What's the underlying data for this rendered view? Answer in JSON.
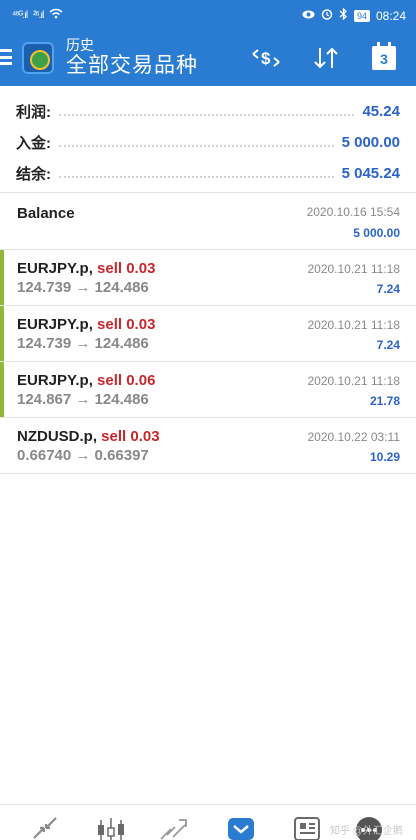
{
  "status_bar": {
    "signal_1": "⁴⁶ᴳ.ıl",
    "signal_2": "²⁶.ıl",
    "battery": "94",
    "time": "08:24"
  },
  "toolbar": {
    "title_small": "历史",
    "title_main": "全部交易品种",
    "currency_icon": "currency-swap-icon",
    "sort_icon": "sort-icon",
    "calendar_day": "3"
  },
  "summary": [
    {
      "label": "利润:",
      "value": "45.24"
    },
    {
      "label": "入金:",
      "value": "5 000.00"
    },
    {
      "label": "结余:",
      "value": "5 045.24"
    }
  ],
  "deals": [
    {
      "symbol": "Balance",
      "type": "",
      "prices": "",
      "time": "2020.10.16 15:54",
      "profit": "5 000.00"
    },
    {
      "symbol": "EURJPY.p,",
      "type": " sell 0.03",
      "prices": "124.739 → 124.486",
      "time": "2020.10.21 11:18",
      "profit": "7.24"
    },
    {
      "symbol": "EURJPY.p,",
      "type": " sell 0.03",
      "prices": "124.739 → 124.486",
      "time": "2020.10.21 11:18",
      "profit": "7.24"
    },
    {
      "symbol": "EURJPY.p,",
      "type": " sell 0.06",
      "prices": "124.867 → 124.486",
      "time": "2020.10.21 11:18",
      "profit": "21.78"
    },
    {
      "symbol": "NZDUSD.p,",
      "type": " sell 0.03",
      "prices": "0.66740 → 0.66397",
      "time": "2020.10.22 03:11",
      "profit": "10.29"
    }
  ],
  "colors": {
    "accent": "#2a7cd2",
    "sell": "#c7262b",
    "profit": "#2a63c9",
    "win_bar": "#92b83a"
  },
  "bottom_nav": [
    "quotes-icon",
    "chart-icon",
    "trade-icon",
    "history-icon",
    "news-icon",
    "chat-icon"
  ],
  "watermark": "知乎 @外汇企鹅"
}
